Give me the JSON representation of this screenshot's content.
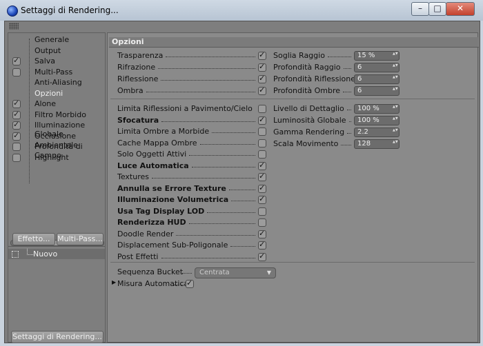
{
  "window": {
    "title": "Settaggi di Rendering..."
  },
  "nav": [
    {
      "label": "Generale",
      "check": "none"
    },
    {
      "label": "Output",
      "check": "none"
    },
    {
      "label": "Salva",
      "check": "on"
    },
    {
      "label": "Multi-Pass",
      "check": "off"
    },
    {
      "label": "Anti-Aliasing",
      "check": "none"
    },
    {
      "label": "Opzioni",
      "check": "none",
      "selected": true
    },
    {
      "label": "Alone",
      "check": "on"
    },
    {
      "label": "Filtro Morbido",
      "check": "on"
    },
    {
      "label": "Illuminazione Globale",
      "check": "on"
    },
    {
      "label": "Occlusione Ambientale",
      "check": "on"
    },
    {
      "label": "Profondità di Campo",
      "check": "off"
    },
    {
      "label": "Highlight",
      "check": "off"
    }
  ],
  "buttons": {
    "effetto": "Effetto...",
    "multipass": "Multi-Pass...",
    "bottom": "Settaggi di Rendering..."
  },
  "new_item": "Nuovo",
  "section_title": "Opzioni",
  "group1_left": [
    {
      "label": "Trasparenza",
      "checked": true
    },
    {
      "label": "Rifrazione",
      "checked": true
    },
    {
      "label": "Riflessione",
      "checked": true
    },
    {
      "label": "Ombra",
      "checked": true
    }
  ],
  "group1_right": [
    {
      "label": "Soglia Raggio",
      "value": "15 %"
    },
    {
      "label": "Profondità Raggio",
      "value": "6"
    },
    {
      "label": "Profondità Riflessione",
      "value": "6"
    },
    {
      "label": "Profondità Ombre",
      "value": "6"
    }
  ],
  "group2_left": [
    {
      "label": "Limita Riflessioni a Pavimento/Cielo",
      "checked": false,
      "bold": false
    },
    {
      "label": "Sfocatura",
      "checked": true,
      "bold": true
    },
    {
      "label": "Limita Ombre a Morbide",
      "checked": false,
      "bold": false
    },
    {
      "label": "Cache Mappa Ombre",
      "checked": false,
      "bold": false
    },
    {
      "label": "Solo Oggetti Attivi",
      "checked": false,
      "bold": false
    },
    {
      "label": "Luce Automatica",
      "checked": true,
      "bold": true
    },
    {
      "label": "Textures",
      "checked": true,
      "bold": false
    },
    {
      "label": "Annulla se Errore Texture",
      "checked": true,
      "bold": true
    },
    {
      "label": "Illuminazione Volumetrica",
      "checked": true,
      "bold": true
    },
    {
      "label": "Usa Tag Display LOD",
      "checked": false,
      "bold": true
    },
    {
      "label": "Renderizza HUD",
      "checked": false,
      "bold": true
    },
    {
      "label": "Doodle Render",
      "checked": true,
      "bold": false
    },
    {
      "label": "Displacement Sub-Poligonale",
      "checked": true,
      "bold": false
    },
    {
      "label": "Post Effetti",
      "checked": true,
      "bold": false
    }
  ],
  "group2_right": [
    {
      "label": "Livello di Dettaglio",
      "value": "100 %"
    },
    {
      "label": "Luminosità Globale",
      "value": "100 %"
    },
    {
      "label": "Gamma Rendering",
      "value": "2.2"
    },
    {
      "label": "Scala Movimento",
      "value": "128"
    }
  ],
  "bucket": {
    "label": "Sequenza Bucket",
    "value": "Centrata"
  },
  "auto_size": {
    "label": "Misura Automatica",
    "checked": true
  }
}
